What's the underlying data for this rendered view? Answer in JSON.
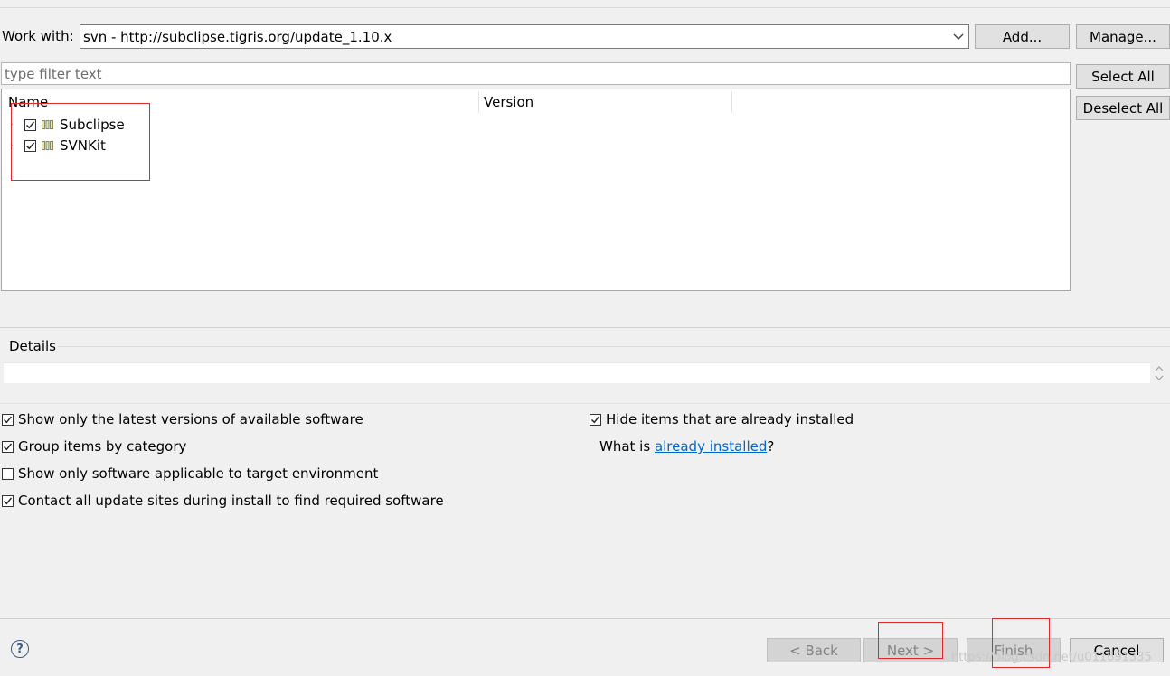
{
  "work_with": {
    "label": "Work with:",
    "value": "svn - http://subclipse.tigris.org/update_1.10.x",
    "add_label": "Add...",
    "manage_label": "Manage..."
  },
  "filter": {
    "placeholder": "type filter text"
  },
  "selection": {
    "select_all_label": "Select All",
    "deselect_all_label": "Deselect All"
  },
  "tree": {
    "columns": [
      "Name",
      "Version"
    ],
    "items": [
      {
        "label": "Subclipse",
        "checked": true
      },
      {
        "label": "SVNKit",
        "checked": true
      }
    ]
  },
  "details": {
    "label": "Details"
  },
  "options": {
    "latest_versions": {
      "label": "Show only the latest versions of available software",
      "checked": true
    },
    "group_by_category": {
      "label": "Group items by category",
      "checked": true
    },
    "applicable_target": {
      "label": "Show only software applicable to target environment",
      "checked": false
    },
    "contact_sites": {
      "label": "Contact all update sites during install to find required software",
      "checked": true
    },
    "hide_installed": {
      "label": "Hide items that are already installed",
      "checked": true
    },
    "what_is_prefix": "What is ",
    "what_is_link": "already installed",
    "what_is_suffix": "?"
  },
  "footer": {
    "help_icon": "?",
    "back_label": "< Back",
    "next_label": "Next >",
    "finish_label": "Finish",
    "cancel_label": "Cancel"
  },
  "watermark": "https://blog.csdn.net/u011691335",
  "colors": {
    "highlight_border": "#e02a2a",
    "link": "#0066cc"
  }
}
